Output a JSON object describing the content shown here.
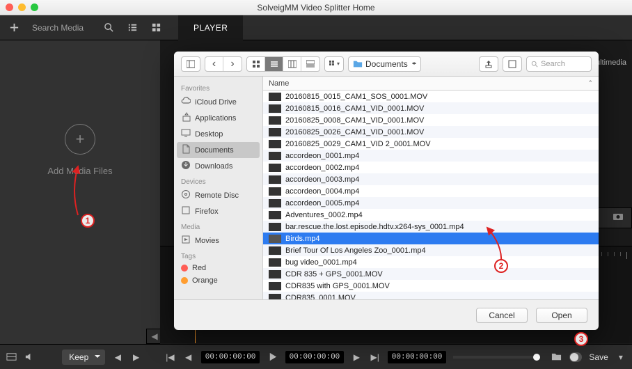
{
  "window": {
    "title": "SolveigMM Video Splitter Home"
  },
  "toolbar": {
    "search_placeholder": "Search Media"
  },
  "tabs": {
    "player": "PLAYER"
  },
  "left_pane": {
    "add_media_label": "Add Media Files"
  },
  "right_hint": {
    "multimedia": "ultimedia"
  },
  "bottombar": {
    "keep_label": "Keep",
    "time_start": "00:00:00:00",
    "time_mid": "00:00:00:00",
    "time_end": "00:00:00:00",
    "save_label": "Save"
  },
  "dialog": {
    "folder_label": "Documents",
    "search_placeholder": "Search",
    "sidebar": {
      "favorites_title": "Favorites",
      "favorites": [
        {
          "icon": "cloud",
          "label": "iCloud Drive"
        },
        {
          "icon": "apps",
          "label": "Applications"
        },
        {
          "icon": "desktop",
          "label": "Desktop"
        },
        {
          "icon": "documents",
          "label": "Documents",
          "active": true
        },
        {
          "icon": "downloads",
          "label": "Downloads"
        }
      ],
      "devices_title": "Devices",
      "devices": [
        {
          "icon": "disc",
          "label": "Remote Disc"
        },
        {
          "icon": "firefox",
          "label": "Firefox"
        }
      ],
      "media_title": "Media",
      "media": [
        {
          "icon": "movies",
          "label": "Movies"
        }
      ],
      "tags_title": "Tags",
      "tags": [
        {
          "color": "#ff5d55",
          "label": "Red"
        },
        {
          "color": "#ff9d2f",
          "label": "Orange"
        }
      ]
    },
    "column_header": "Name",
    "files": [
      "20160815_0015_CAM1_SOS_0001.MOV",
      "20160815_0016_CAM1_VID_0001.MOV",
      "20160825_0008_CAM1_VID_0001.MOV",
      "20160825_0026_CAM1_VID_0001.MOV",
      "20160825_0029_CAM1_VID 2_0001.MOV",
      "accordeon_0001.mp4",
      "accordeon_0002.mp4",
      "accordeon_0003.mp4",
      "accordeon_0004.mp4",
      "accordeon_0005.mp4",
      "Adventures_0002.mp4",
      "bar.rescue.the.lost.episode.hdtv.x264-sys_0001.mp4",
      "Birds.mp4",
      "Brief Tour Of Los Angeles Zoo_0001.mp4",
      "bug video_0001.mp4",
      "CDR 835 + GPS_0001.MOV",
      "CDR835 with GPS_0001.MOV",
      "CDR835_0001.MOV"
    ],
    "selected_index": 12,
    "cancel_label": "Cancel",
    "open_label": "Open"
  },
  "callouts": {
    "c1": "1",
    "c2": "2",
    "c3": "3"
  }
}
